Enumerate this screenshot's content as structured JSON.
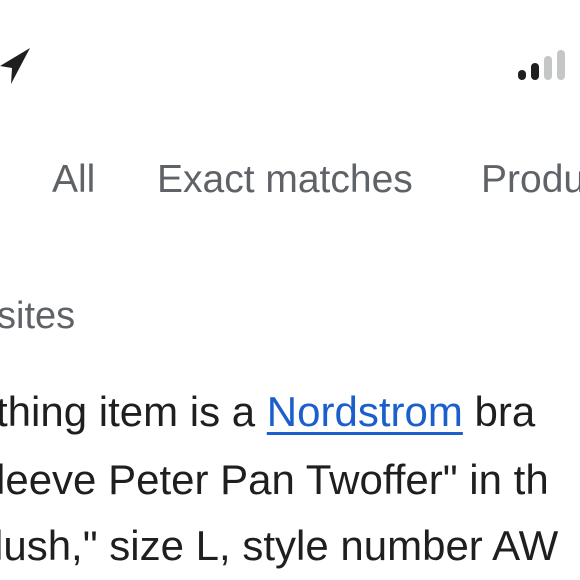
{
  "status_bar": {
    "location_icon": "location-arrow-icon",
    "signal_icon": "cellular-signal-icon",
    "signal_bars_active": 2,
    "signal_bars_total": 4
  },
  "tabs": [
    {
      "label": "All"
    },
    {
      "label": "Exact matches"
    },
    {
      "label": "Produ"
    }
  ],
  "section": {
    "heading": "sites"
  },
  "description": {
    "line1_before": "thing item is a ",
    "line1_link": "Nordstrom",
    "line1_after": " bra",
    "line2": "leeve Peter Pan Twoffer\" in th",
    "line3": "lush,\" size L, style number AW"
  },
  "colors": {
    "link": "#1a5fcc",
    "muted_text": "#5f6368",
    "body_text": "#1f1f1f",
    "signal_active": "#1f1f1f",
    "signal_inactive": "#c4c7c5"
  }
}
